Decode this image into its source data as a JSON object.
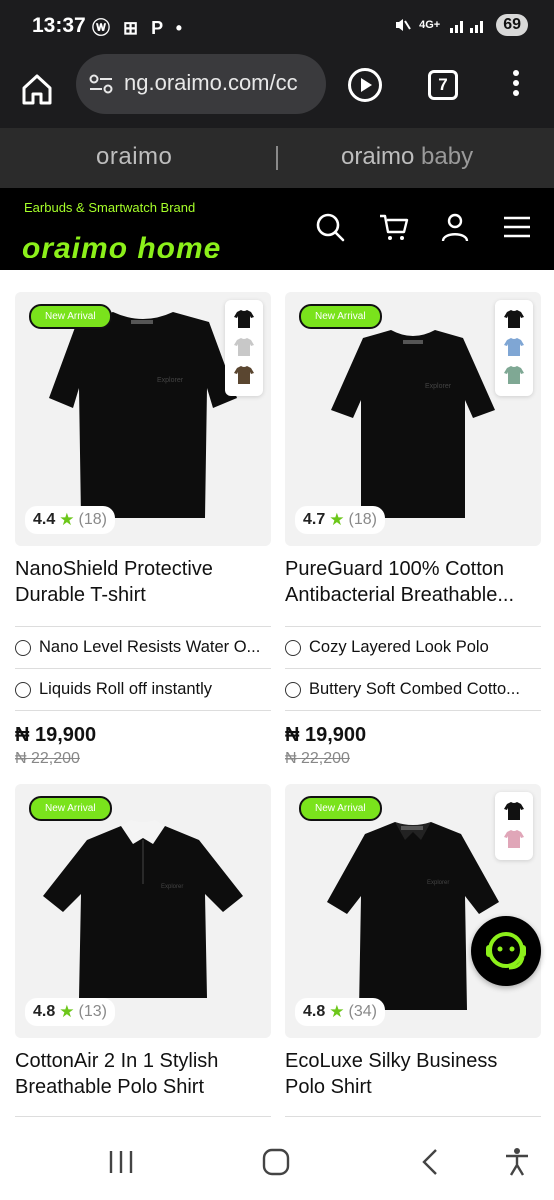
{
  "status_bar": {
    "time": "13:37",
    "left_icons": "ⓦ ⊞ P •",
    "network": "4G+",
    "battery": "69"
  },
  "browser": {
    "url": "ng.oraimo.com/cc",
    "tab_count": "7"
  },
  "brand_bar": {
    "brand_main": "oraimo",
    "brand_baby_1": "oraimo",
    "brand_baby_2": "baby"
  },
  "header": {
    "tagline": "Earbuds & Smartwatch Brand",
    "logo_text": "oraimo home"
  },
  "currency_symbol": "₦",
  "products": [
    {
      "badge": "New Arrival",
      "rating": "4.4",
      "reviews": "(18)",
      "name_line1": "NanoShield Protective",
      "name_line2": "Durable T-shirt",
      "feature1": "Nano Level Resists Water O...",
      "feature2": "Liquids Roll off instantly",
      "price": "₦ 19,900",
      "old_price": "₦ 22,200",
      "swatches": [
        "#111111",
        "#c8c8c8",
        "#5a4630"
      ]
    },
    {
      "badge": "New Arrival",
      "rating": "4.7",
      "reviews": "(18)",
      "name_line1": "PureGuard 100% Cotton",
      "name_line2": "Antibacterial Breathable...",
      "feature1": "Cozy Layered Look Polo",
      "feature2": "Buttery Soft Combed Cotto...",
      "price": "₦ 19,900",
      "old_price": "₦ 22,200",
      "swatches": [
        "#111111",
        "#7fa6d4",
        "#7fa894"
      ]
    },
    {
      "badge": "New Arrival",
      "rating": "4.8",
      "reviews": "(13)",
      "name_line1": "CottonAir 2 In 1 Stylish",
      "name_line2": "Breathable Polo Shirt",
      "swatches": []
    },
    {
      "badge": "New Arrival",
      "rating": "4.8",
      "reviews": "(34)",
      "name_line1": "EcoLuxe Silky Business",
      "name_line2": "Polo Shirt",
      "swatches": [
        "#111111",
        "#e0a6b8"
      ]
    }
  ],
  "colors": {
    "accent_green": "#7ae31c",
    "header_black": "#000000",
    "status_bar": "#1c1c1e"
  }
}
